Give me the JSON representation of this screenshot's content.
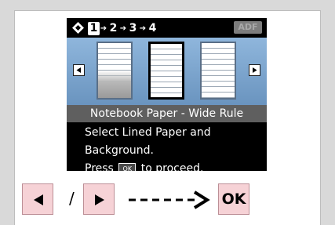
{
  "steps": [
    "1",
    "2",
    "3",
    "4"
  ],
  "adf_label": "ADF",
  "caption": "Notebook Paper - Wide Rule",
  "message": {
    "line1": "Select Lined Paper and",
    "line2": "Background.",
    "line3_before": "Press",
    "ok_key": "OK",
    "line3_after": "to proceed."
  },
  "controls": {
    "slash": "/",
    "ok_label": "OK"
  },
  "colors": {
    "button_fill": "#f6d2d6",
    "lcd_bg": "#000000",
    "carousel_bg": "#7fa6cf"
  }
}
